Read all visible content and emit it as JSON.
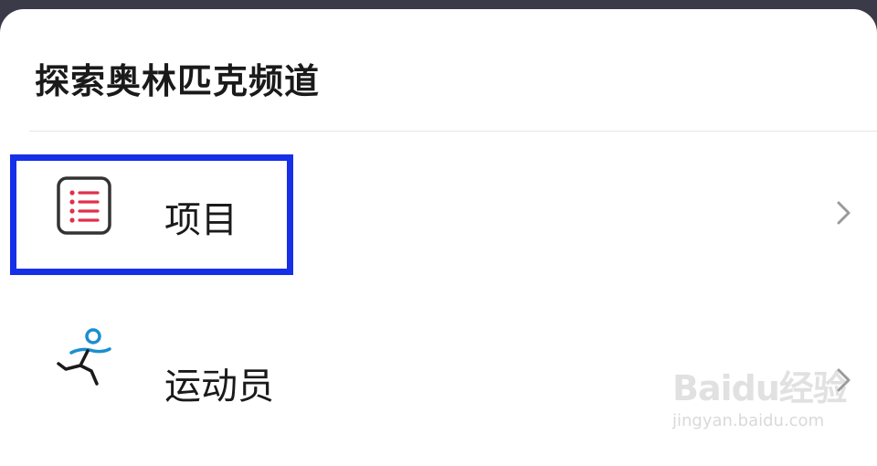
{
  "sheet": {
    "title": "探索奥林匹克频道"
  },
  "menu": {
    "items": [
      {
        "label": "项目",
        "icon": "list-icon",
        "highlighted": true,
        "icon_color": "#e0304a"
      },
      {
        "label": "运动员",
        "icon": "runner-icon",
        "highlighted": false,
        "icon_color": "#1a8fd0"
      }
    ]
  },
  "highlight_color": "#1530e8",
  "watermark": {
    "logo": "Baidu经验",
    "url": "jingyan.baidu.com"
  }
}
